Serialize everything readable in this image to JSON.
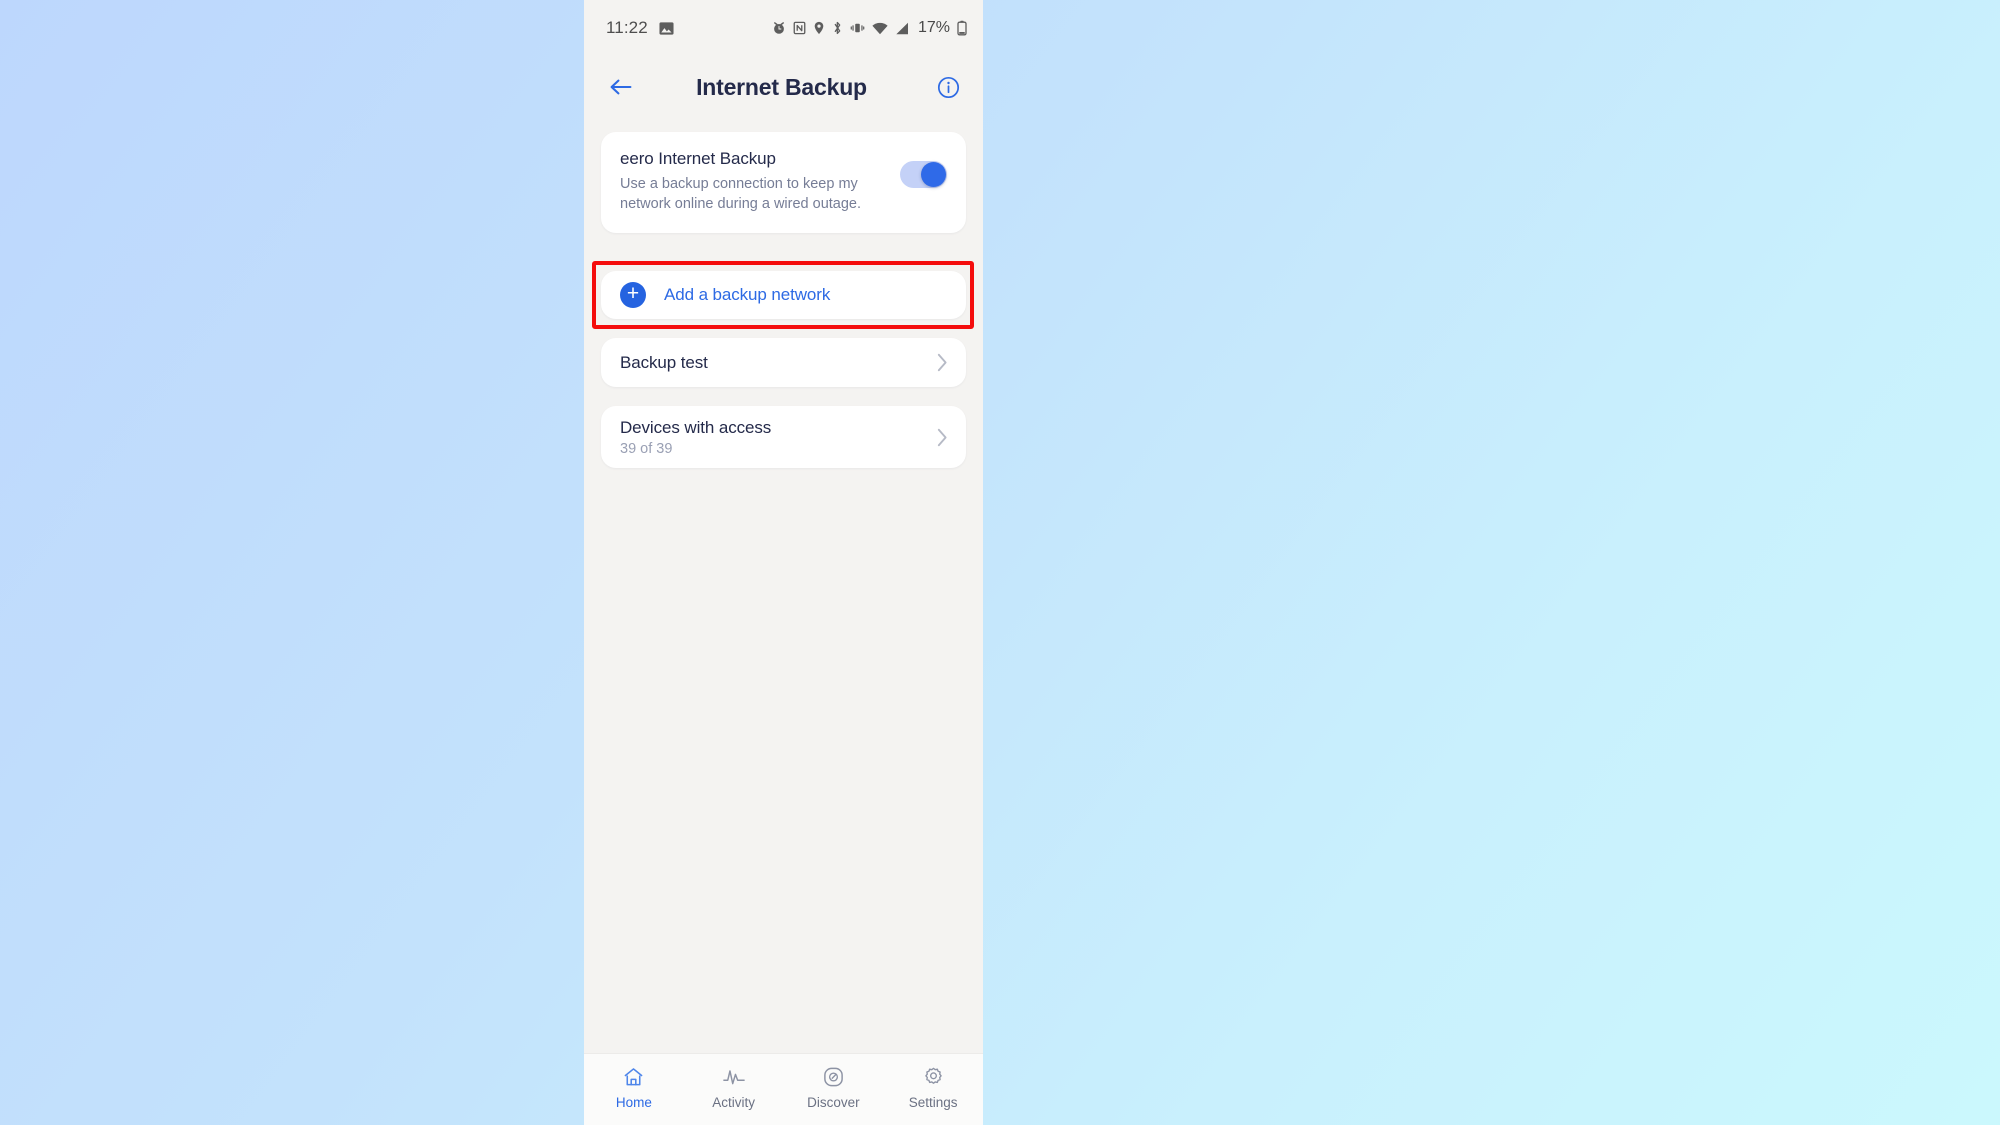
{
  "theme": {
    "accent_blue": "#2d6ae4",
    "highlight_red": "#f40d0d",
    "title_navy": "#242a4a",
    "muted_text": "#767d96",
    "card_white": "#ffffff",
    "app_bg": "#f4f3f1",
    "backdrop_from": "#bdd7fd",
    "backdrop_to": "#cbf8fd",
    "toggle_track": "#c4d1f7",
    "toggle_knob": "#2f6ae8"
  },
  "status_bar": {
    "time": "11:22",
    "left_icons": [
      "photo-icon"
    ],
    "right_icons": [
      "alarm-clock-icon",
      "nfc-icon",
      "location-pin-icon",
      "bluetooth-icon",
      "vibrate-icon",
      "wifi-icon",
      "cellular-signal-icon"
    ],
    "battery_percent": "17%",
    "battery_icon": "battery-icon"
  },
  "app_bar": {
    "back_icon": "arrow-left-icon",
    "title": "Internet Backup",
    "info_icon": "info-circle-icon"
  },
  "main": {
    "eero_card": {
      "title": "eero Internet Backup",
      "description": "Use a backup connection to keep my network online during a wired outage.",
      "toggle_state": "on"
    },
    "add_backup_row": {
      "icon": "plus-circle-icon",
      "label": "Add a backup network",
      "highlighted": true
    },
    "rows": [
      {
        "title": "Backup test",
        "subtitle": "",
        "chevron": "chevron-right-icon"
      },
      {
        "title": "Devices with access",
        "subtitle": "39 of 39",
        "chevron": "chevron-right-icon"
      }
    ]
  },
  "tab_bar": {
    "items": [
      {
        "label": "Home",
        "icon": "home-icon",
        "active": true
      },
      {
        "label": "Activity",
        "icon": "pulse-icon",
        "active": false
      },
      {
        "label": "Discover",
        "icon": "compass-icon",
        "active": false
      },
      {
        "label": "Settings",
        "icon": "gear-icon",
        "active": false
      }
    ]
  }
}
